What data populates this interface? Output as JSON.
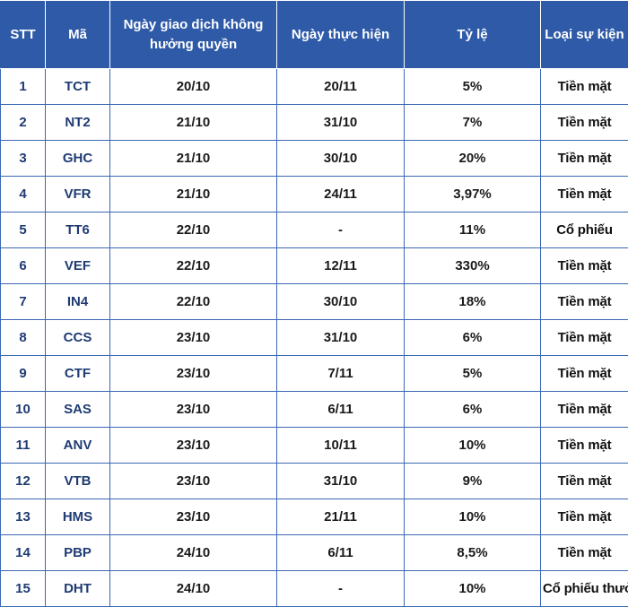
{
  "table": {
    "headers": [
      "STT",
      "Mã",
      "Ngày giao dịch không hưởng quyền",
      "Ngày thực hiện",
      "Tỷ lệ",
      "Loại sự kiện"
    ],
    "rows": [
      {
        "stt": "1",
        "ma": "TCT",
        "gdkhq": "20/10",
        "thuc_hien": "20/11",
        "ty_le": "5%",
        "loai": "Tiền mặt"
      },
      {
        "stt": "2",
        "ma": "NT2",
        "gdkhq": "21/10",
        "thuc_hien": "31/10",
        "ty_le": "7%",
        "loai": "Tiền mặt"
      },
      {
        "stt": "3",
        "ma": "GHC",
        "gdkhq": "21/10",
        "thuc_hien": "30/10",
        "ty_le": "20%",
        "loai": "Tiền mặt"
      },
      {
        "stt": "4",
        "ma": "VFR",
        "gdkhq": "21/10",
        "thuc_hien": "24/11",
        "ty_le": "3,97%",
        "loai": "Tiền mặt"
      },
      {
        "stt": "5",
        "ma": "TT6",
        "gdkhq": "22/10",
        "thuc_hien": "-",
        "ty_le": "11%",
        "loai": "Cổ phiếu"
      },
      {
        "stt": "6",
        "ma": "VEF",
        "gdkhq": "22/10",
        "thuc_hien": "12/11",
        "ty_le": "330%",
        "loai": "Tiền mặt"
      },
      {
        "stt": "7",
        "ma": "IN4",
        "gdkhq": "22/10",
        "thuc_hien": "30/10",
        "ty_le": "18%",
        "loai": "Tiền mặt"
      },
      {
        "stt": "8",
        "ma": "CCS",
        "gdkhq": "23/10",
        "thuc_hien": "31/10",
        "ty_le": "6%",
        "loai": "Tiền mặt"
      },
      {
        "stt": "9",
        "ma": "CTF",
        "gdkhq": "23/10",
        "thuc_hien": "7/11",
        "ty_le": "5%",
        "loai": "Tiền mặt"
      },
      {
        "stt": "10",
        "ma": "SAS",
        "gdkhq": "23/10",
        "thuc_hien": "6/11",
        "ty_le": "6%",
        "loai": "Tiền mặt"
      },
      {
        "stt": "11",
        "ma": "ANV",
        "gdkhq": "23/10",
        "thuc_hien": "10/11",
        "ty_le": "10%",
        "loai": "Tiền mặt"
      },
      {
        "stt": "12",
        "ma": "VTB",
        "gdkhq": "23/10",
        "thuc_hien": "31/10",
        "ty_le": "9%",
        "loai": "Tiền mặt"
      },
      {
        "stt": "13",
        "ma": "HMS",
        "gdkhq": "23/10",
        "thuc_hien": "21/11",
        "ty_le": "10%",
        "loai": "Tiền mặt"
      },
      {
        "stt": "14",
        "ma": "PBP",
        "gdkhq": "24/10",
        "thuc_hien": "6/11",
        "ty_le": "8,5%",
        "loai": "Tiền mặt"
      },
      {
        "stt": "15",
        "ma": "DHT",
        "gdkhq": "24/10",
        "thuc_hien": "-",
        "ty_le": "10%",
        "loai": "Cổ phiếu thưởng"
      }
    ]
  },
  "colors": {
    "header_bg": "#2e5aa8",
    "header_text": "#ffffff",
    "grid_line": "#3a68b4",
    "id_text": "#1f3b73"
  }
}
